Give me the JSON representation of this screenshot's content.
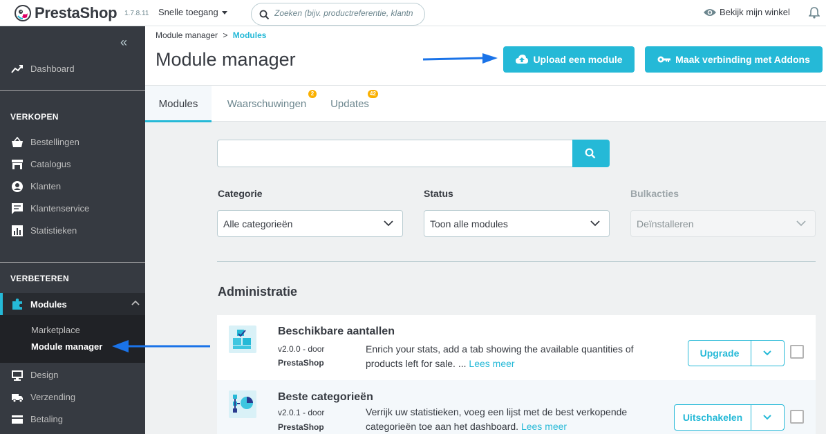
{
  "header": {
    "brand": "PrestaShop",
    "version": "1.7.8.11",
    "quick_access": "Snelle toegang",
    "search_placeholder": "Zoeken (bijv. productreferentie, klantn",
    "view_shop": "Bekijk mijn winkel"
  },
  "sidebar": {
    "dashboard": "Dashboard",
    "section_sell": "VERKOPEN",
    "sell_items": [
      "Bestellingen",
      "Catalogus",
      "Klanten",
      "Klantenservice",
      "Statistieken"
    ],
    "section_improve": "VERBETEREN",
    "modules": "Modules",
    "sub_items": [
      "Marketplace",
      "Module manager"
    ],
    "more_items": [
      "Design",
      "Verzending",
      "Betaling"
    ]
  },
  "page": {
    "breadcrumb_parent": "Module manager",
    "breadcrumb_sep": ">",
    "breadcrumb_current": "Modules",
    "title": "Module manager",
    "upload_button": "Upload een module",
    "connect_button": "Maak verbinding met Addons"
  },
  "tabs": [
    {
      "label": "Modules",
      "badge": ""
    },
    {
      "label": "Waarschuwingen",
      "badge": "2"
    },
    {
      "label": "Updates",
      "badge": "42"
    }
  ],
  "filters": {
    "search_value": "",
    "category_label": "Categorie",
    "category_value": "Alle categorieën",
    "status_label": "Status",
    "status_value": "Toon alle modules",
    "bulk_label": "Bulkacties",
    "bulk_value": "Deïnstalleren"
  },
  "category_title": "Administratie",
  "modules": [
    {
      "name": "Beschikbare aantallen",
      "version": "v2.0.0 - door",
      "author": "PrestaShop",
      "description": "Enrich your stats, add a tab showing the available quantities of products left for sale. ...",
      "more": "Lees meer",
      "action": "Upgrade"
    },
    {
      "name": "Beste categorieën",
      "version": "v2.0.1 - door",
      "author": "PrestaShop",
      "description": "Verrijk uw statistieken, voeg een lijst met de best verkopende categorieën toe aan het dashboard.",
      "more": "Lees meer",
      "action": "Uitschakelen"
    }
  ],
  "colors": {
    "accent": "#25b9d7",
    "sidebar": "#363a41",
    "badge": "#fab000",
    "arrow": "#1a73e8"
  }
}
